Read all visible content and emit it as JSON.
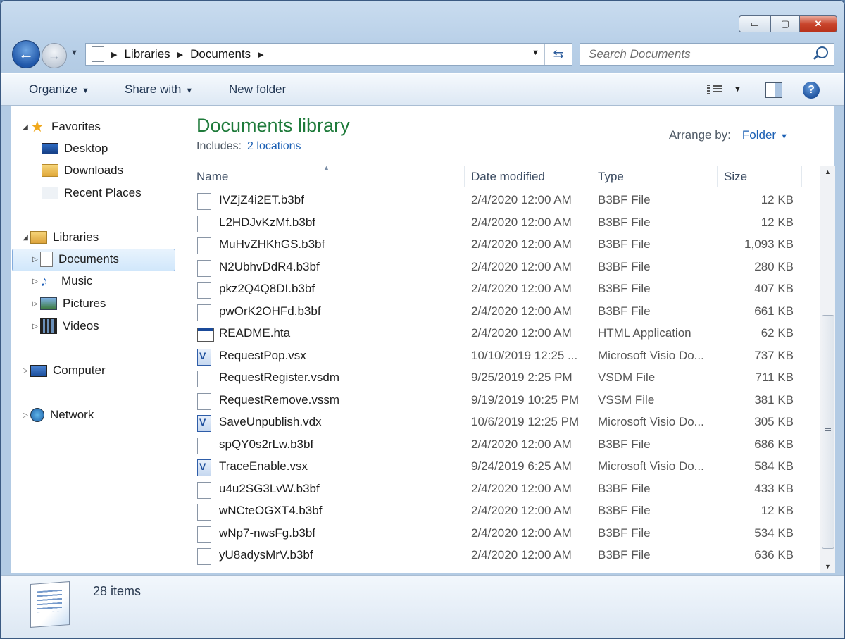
{
  "window": {
    "minimize_glyph": "▭",
    "maximize_glyph": "▢",
    "close_glyph": "✕"
  },
  "address": {
    "crumbs": [
      "Libraries",
      "Documents"
    ]
  },
  "search": {
    "placeholder": "Search Documents"
  },
  "toolbar": {
    "organize": "Organize",
    "share_with": "Share with",
    "new_folder": "New folder"
  },
  "navpane": {
    "favorites": "Favorites",
    "desktop": "Desktop",
    "downloads": "Downloads",
    "recent_places": "Recent Places",
    "libraries": "Libraries",
    "documents": "Documents",
    "music": "Music",
    "pictures": "Pictures",
    "videos": "Videos",
    "computer": "Computer",
    "network": "Network"
  },
  "library": {
    "title": "Documents library",
    "includes_label": "Includes:",
    "includes_link": "2 locations",
    "arrange_label": "Arrange by:",
    "arrange_value": "Folder"
  },
  "columns": {
    "name": "Name",
    "date": "Date modified",
    "type": "Type",
    "size": "Size"
  },
  "files": [
    {
      "name": "IVZjZ4i2ET.b3bf",
      "date": "2/4/2020 12:00 AM",
      "type": "B3BF File",
      "size": "12 KB",
      "icon": "generic"
    },
    {
      "name": "L2HDJvKzMf.b3bf",
      "date": "2/4/2020 12:00 AM",
      "type": "B3BF File",
      "size": "12 KB",
      "icon": "generic"
    },
    {
      "name": "MuHvZHKhGS.b3bf",
      "date": "2/4/2020 12:00 AM",
      "type": "B3BF File",
      "size": "1,093 KB",
      "icon": "generic"
    },
    {
      "name": "N2UbhvDdR4.b3bf",
      "date": "2/4/2020 12:00 AM",
      "type": "B3BF File",
      "size": "280 KB",
      "icon": "generic"
    },
    {
      "name": "pkz2Q4Q8DI.b3bf",
      "date": "2/4/2020 12:00 AM",
      "type": "B3BF File",
      "size": "407 KB",
      "icon": "generic"
    },
    {
      "name": "pwOrK2OHFd.b3bf",
      "date": "2/4/2020 12:00 AM",
      "type": "B3BF File",
      "size": "661 KB",
      "icon": "generic"
    },
    {
      "name": "README.hta",
      "date": "2/4/2020 12:00 AM",
      "type": "HTML Application",
      "size": "62 KB",
      "icon": "hta"
    },
    {
      "name": "RequestPop.vsx",
      "date": "10/10/2019 12:25 ...",
      "type": "Microsoft Visio Do...",
      "size": "737 KB",
      "icon": "visio"
    },
    {
      "name": "RequestRegister.vsdm",
      "date": "9/25/2019 2:25 PM",
      "type": "VSDM File",
      "size": "711 KB",
      "icon": "generic"
    },
    {
      "name": "RequestRemove.vssm",
      "date": "9/19/2019 10:25 PM",
      "type": "VSSM File",
      "size": "381 KB",
      "icon": "generic"
    },
    {
      "name": "SaveUnpublish.vdx",
      "date": "10/6/2019 12:25 PM",
      "type": "Microsoft Visio Do...",
      "size": "305 KB",
      "icon": "visio"
    },
    {
      "name": "spQY0s2rLw.b3bf",
      "date": "2/4/2020 12:00 AM",
      "type": "B3BF File",
      "size": "686 KB",
      "icon": "generic"
    },
    {
      "name": "TraceEnable.vsx",
      "date": "9/24/2019 6:25 AM",
      "type": "Microsoft Visio Do...",
      "size": "584 KB",
      "icon": "visio"
    },
    {
      "name": "u4u2SG3LvW.b3bf",
      "date": "2/4/2020 12:00 AM",
      "type": "B3BF File",
      "size": "433 KB",
      "icon": "generic"
    },
    {
      "name": "wNCteOGXT4.b3bf",
      "date": "2/4/2020 12:00 AM",
      "type": "B3BF File",
      "size": "12 KB",
      "icon": "generic"
    },
    {
      "name": "wNp7-nwsFg.b3bf",
      "date": "2/4/2020 12:00 AM",
      "type": "B3BF File",
      "size": "534 KB",
      "icon": "generic"
    },
    {
      "name": "yU8adysMrV.b3bf",
      "date": "2/4/2020 12:00 AM",
      "type": "B3BF File",
      "size": "636 KB",
      "icon": "generic"
    }
  ],
  "details": {
    "count": "28 items"
  }
}
